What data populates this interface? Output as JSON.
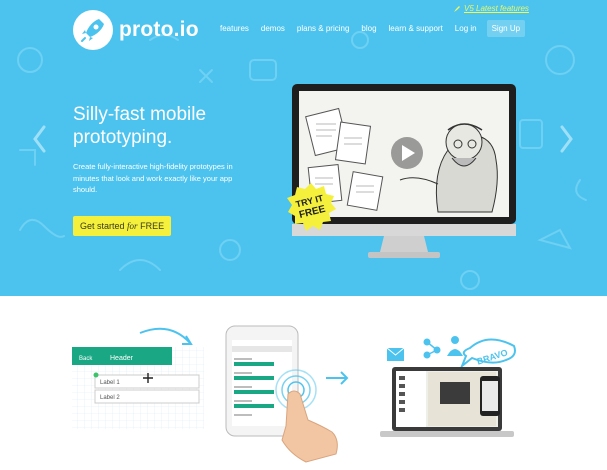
{
  "brand": {
    "name": "proto.io"
  },
  "promo": {
    "label": "V5 Latest features"
  },
  "nav": {
    "items": [
      {
        "label": "features"
      },
      {
        "label": "demos"
      },
      {
        "label": "plans & pricing"
      },
      {
        "label": "blog"
      },
      {
        "label": "learn & support"
      },
      {
        "label": "Log in"
      }
    ],
    "signup": "Sign Up"
  },
  "hero": {
    "title": "Silly-fast mobile prototyping.",
    "subtitle": "Create fully-interactive high-fidelity prototypes in minutes that look and work exactly like your app should.",
    "cta_prefix": "Get started",
    "cta_for": "for",
    "cta_suffix": "FREE",
    "badge_line1": "TRY IT",
    "badge_line2": "FREE"
  },
  "illustrations": {
    "mock_back": "Back",
    "mock_header": "Header",
    "label1": "Label 1",
    "label2": "Label 2",
    "bravo": "BRAVO"
  },
  "colors": {
    "hero_bg": "#4cc3ee",
    "cta_bg": "#f4f03b",
    "accent_green": "#1aa784",
    "promo": "#ecf85e"
  }
}
